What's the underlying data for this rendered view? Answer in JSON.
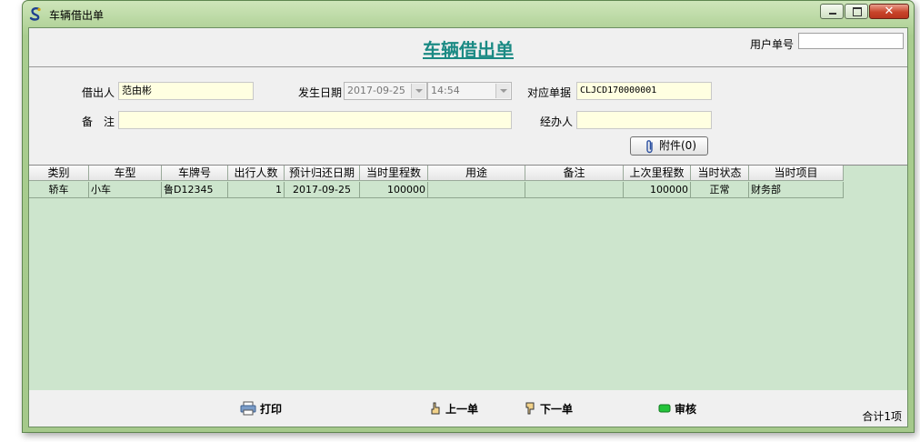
{
  "window": {
    "title": "车辆借出单"
  },
  "header": {
    "form_title": "车辆借出单",
    "user_no_label": "用户单号",
    "user_no_value": ""
  },
  "form": {
    "borrower_label": "借出人",
    "borrower_value": "范由彬",
    "date_label": "发生日期",
    "date_value": "2017-09-25",
    "time_value": "14:54",
    "ref_label": "对应单据",
    "ref_value": "CLJCD170000001",
    "remark_label": "备　注",
    "remark_value": "",
    "handler_label": "经办人",
    "handler_value": "",
    "attach_label": "附件(0)"
  },
  "grid": {
    "columns": [
      "类别",
      "车型",
      "车牌号",
      "出行人数",
      "预计归还日期",
      "当时里程数",
      "用途",
      "备注",
      "上次里程数",
      "当时状态",
      "当时项目"
    ],
    "rows": [
      [
        "轿车",
        "小车",
        "鲁D12345",
        "1",
        "2017-09-25",
        "100000",
        "",
        "",
        "100000",
        "正常",
        "财务部"
      ]
    ]
  },
  "footer": {
    "print_label": "打印",
    "prev_label": "上一单",
    "next_label": "下一单",
    "audit_label": "审核",
    "total_label": "合计1项"
  }
}
